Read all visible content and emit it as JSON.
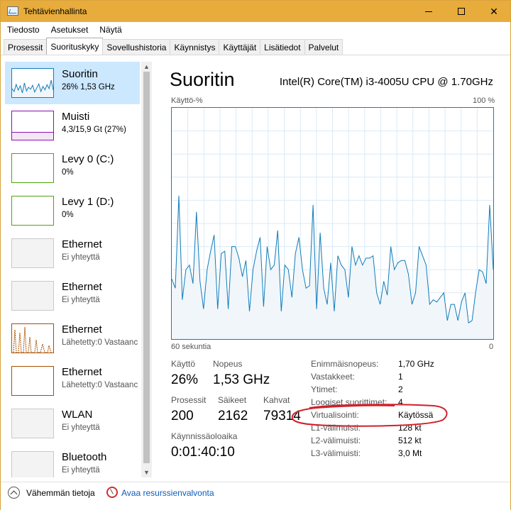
{
  "window": {
    "title": "Tehtävienhallinta"
  },
  "menu": [
    "Tiedosto",
    "Asetukset",
    "Näytä"
  ],
  "tabs": [
    "Prosessit",
    "Suorituskyky",
    "Sovellushistoria",
    "Käynnistys",
    "Käyttäjät",
    "Lisätiedot",
    "Palvelut"
  ],
  "active_tab": "Suorituskyky",
  "sidebar": {
    "items": [
      {
        "name": "Suoritin",
        "sub": "26% 1,53 GHz",
        "color": "#117dbb"
      },
      {
        "name": "Muisti",
        "sub": "4,3/15,9 Gt (27%)",
        "color": "#8b12ae"
      },
      {
        "name": "Levy 0 (C:)",
        "sub": "0%",
        "color": "#4da60c"
      },
      {
        "name": "Levy 1 (D:)",
        "sub": "0%",
        "color": "#4da60c"
      },
      {
        "name": "Ethernet",
        "sub": "Ei yhteyttä",
        "color": "#c9c9c9"
      },
      {
        "name": "Ethernet",
        "sub": "Ei yhteyttä",
        "color": "#c9c9c9"
      },
      {
        "name": "Ethernet",
        "sub": "Lähetetty:0 Vastaanc",
        "color": "#a74f01"
      },
      {
        "name": "Ethernet",
        "sub": "Lähetetty:0 Vastaanc",
        "color": "#a74f01"
      },
      {
        "name": "WLAN",
        "sub": "Ei yhteyttä",
        "color": "#c9c9c9"
      },
      {
        "name": "Bluetooth",
        "sub": "Ei yhteyttä",
        "color": "#c9c9c9"
      }
    ]
  },
  "main": {
    "title": "Suoritin",
    "cpu_model": "Intel(R) Core(TM) i3-4005U CPU @ 1.70GHz",
    "graph_top_left": "Käyttö-%",
    "graph_top_right": "100 %",
    "graph_bottom_left": "60 sekuntia",
    "graph_bottom_right": "0"
  },
  "stats": {
    "usage_label": "Käyttö",
    "usage_value": "26%",
    "speed_label": "Nopeus",
    "speed_value": "1,53 GHz",
    "processes_label": "Prosessit",
    "processes_value": "200",
    "threads_label": "Säikeet",
    "threads_value": "2162",
    "handles_label": "Kahvat",
    "handles_value": "79314",
    "uptime_label": "Käynnissäoloaika",
    "uptime_value": "0:01:40:10"
  },
  "details": [
    {
      "k": "Enimmäisnopeus:",
      "v": "1,70 GHz"
    },
    {
      "k": "Vastakkeet:",
      "v": "1"
    },
    {
      "k": "Ytimet:",
      "v": "2"
    },
    {
      "k": "Loogiset suorittimet:",
      "v": "4"
    },
    {
      "k": "Virtualisointi:",
      "v": "Käytössä"
    },
    {
      "k": "L1-välimuisti:",
      "v": "128 kt"
    },
    {
      "k": "L2-välimuisti:",
      "v": "512 kt"
    },
    {
      "k": "L3-välimuisti:",
      "v": "3,0 Mt"
    }
  ],
  "bottom": {
    "fewer": "Vähemmän tietoja",
    "resmon": "Avaa resurssienvalvonta"
  },
  "cpu_history": [
    26,
    22,
    62,
    17,
    30,
    32,
    24,
    55,
    25,
    13,
    30,
    38,
    45,
    13,
    37,
    38,
    13,
    40,
    40,
    35,
    27,
    34,
    12,
    30,
    38,
    44,
    14,
    40,
    30,
    32,
    47,
    12,
    32,
    30,
    18,
    37,
    44,
    30,
    22,
    23,
    58,
    13,
    46,
    22,
    15,
    33,
    12,
    36,
    32,
    30,
    18,
    40,
    32,
    36,
    32,
    35,
    35,
    36,
    20,
    15,
    25,
    19,
    40,
    30,
    33,
    34,
    34,
    28,
    15,
    20,
    40,
    36,
    32,
    15,
    17,
    16,
    18,
    20,
    8,
    15,
    15,
    8,
    16,
    20,
    7,
    8,
    20,
    30,
    29,
    24,
    58,
    30
  ],
  "thumb_cpu": [
    30,
    20,
    45,
    25,
    40,
    15,
    50,
    22,
    35,
    28,
    42,
    18,
    33,
    47,
    20,
    38,
    26,
    44,
    30,
    60,
    25
  ],
  "accent": "#117dbb",
  "annotation_color": "#d0202a"
}
